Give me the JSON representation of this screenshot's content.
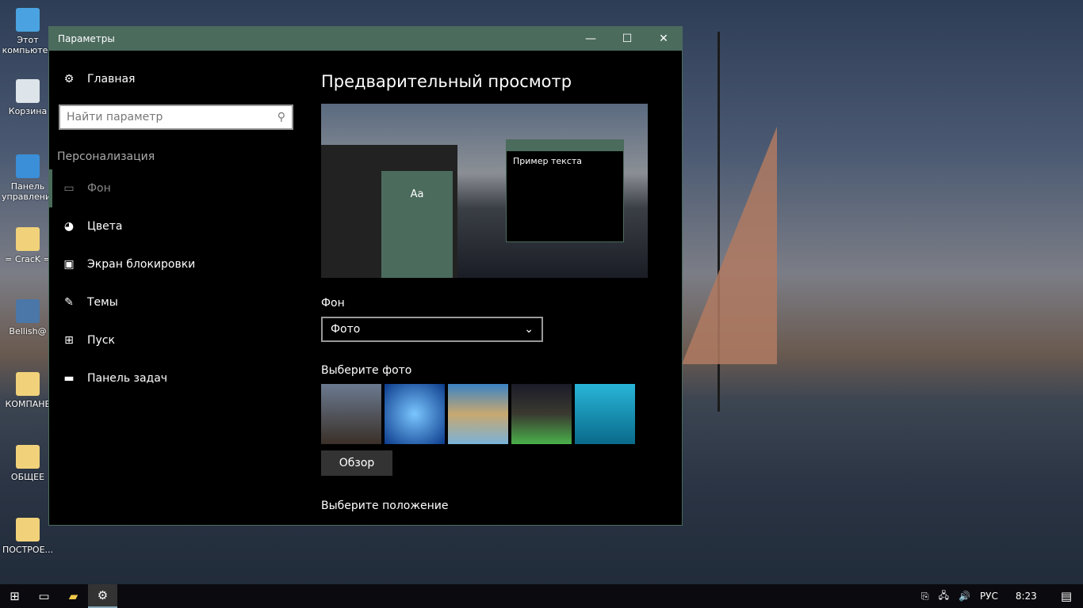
{
  "desktop": {
    "icons": [
      {
        "label": "Этот компьютер",
        "color": "#4aa3e0"
      },
      {
        "label": "Корзина",
        "color": "#dde4ea"
      },
      {
        "label": "Панель управления",
        "color": "#3b8ed8"
      },
      {
        "label": "= CracK =",
        "color": "#f1d27a"
      },
      {
        "label": "Bellish@",
        "color": "#4a76a8"
      },
      {
        "label": "КОМПАНЕ",
        "color": "#f1d27a"
      },
      {
        "label": "ОБЩЕЕ",
        "color": "#f1d27a"
      },
      {
        "label": "ПОСТРОЕ...",
        "color": "#f1d27a"
      }
    ]
  },
  "window": {
    "title": "Параметры",
    "accent": "#4b6b5d"
  },
  "sidebar": {
    "home": "Главная",
    "search_placeholder": "Найти параметр",
    "section": "Персонализация",
    "items": [
      {
        "label": "Фон",
        "icon": "picture-icon",
        "active": true
      },
      {
        "label": "Цвета",
        "icon": "palette-icon"
      },
      {
        "label": "Экран блокировки",
        "icon": "lock-screen-icon"
      },
      {
        "label": "Темы",
        "icon": "themes-icon"
      },
      {
        "label": "Пуск",
        "icon": "start-icon"
      },
      {
        "label": "Панель задач",
        "icon": "taskbar-icon"
      }
    ]
  },
  "main": {
    "title": "Предварительный просмотр",
    "preview_tile": "Aa",
    "preview_sample": "Пример текста",
    "bg_label": "Фон",
    "bg_value": "Фото",
    "choose_photo": "Выберите фото",
    "browse": "Обзор",
    "choose_fit": "Выберите положение"
  },
  "taskbar": {
    "lang": "РУС",
    "time": "8:23"
  }
}
